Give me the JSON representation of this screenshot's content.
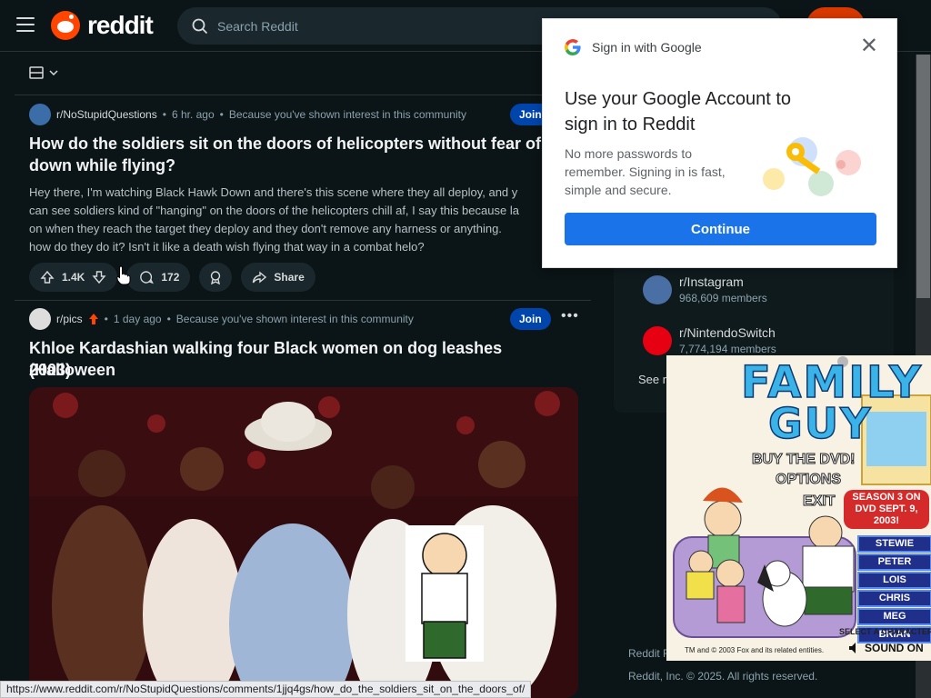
{
  "header": {
    "logo_text": "reddit",
    "search_placeholder": "Search Reddit"
  },
  "posts": [
    {
      "subreddit": "r/NoStupidQuestions",
      "time": "6 hr. ago",
      "reason": "Because you've shown interest in this community",
      "join_label": "Join",
      "title": "How do the soldiers sit on the doors of helicopters without fear of fal",
      "title_line2": "down while flying?",
      "body": [
        "Hey there, I'm watching Black Hawk Down and there's this scene where they all deploy, and y",
        "can see soldiers kind of \"hanging\" on the doors of the helicopters chill af, I say this because la",
        "on when they reach the target they deploy and they don't remove any harness or anything.",
        "how do they do it? Isn't it like a death wish flying that way in a combat helo?"
      ],
      "upvotes": "1.4K",
      "comments": "172",
      "share_label": "Share"
    },
    {
      "subreddit": "r/pics",
      "time": "1 day ago",
      "reason": "Because you've shown interest in this community",
      "join_label": "Join",
      "title": "Khloe Kardashian walking four Black women on dog leashes (Halloween",
      "title_line2": "2003)"
    }
  ],
  "sidebar": {
    "communities": [
      {
        "name": "r/Instagram",
        "members": "968,609 members",
        "color": "#4a6fa5"
      },
      {
        "name": "r/NintendoSwitch",
        "members": "7,774,194 members",
        "color": "#e60012"
      }
    ],
    "see_more": "See more",
    "footer_rules": "Reddit Ru",
    "copyright": "Reddit, Inc. © 2025. All rights reserved."
  },
  "google_popup": {
    "header": "Sign in with Google",
    "title": "Use your Google Account to sign in to Reddit",
    "body": "No more passwords to remember. Signing in is fast, simple and secure.",
    "continue_label": "Continue"
  },
  "ad": {
    "title_line1": "FAMILY",
    "title_line2": "GUY",
    "buy_dvd": "BUY THE DVD!",
    "options": "OPTIONS",
    "exit": "EXIT",
    "season": "SEASON 3 ON DVD SEPT. 9, 2003!",
    "characters": [
      "STEWIE",
      "PETER",
      "LOIS",
      "CHRIS",
      "MEG",
      "BRIAN"
    ],
    "select_hint": "SELECT A CHARACTER ABOVE",
    "legal": "TM and © 2003 Fox and its related entities.",
    "sound": "SOUND ON"
  },
  "status_url": "https://www.reddit.com/r/NoStupidQuestions/comments/1jjq4gs/how_do_the_soldiers_sit_on_the_doors_of/"
}
